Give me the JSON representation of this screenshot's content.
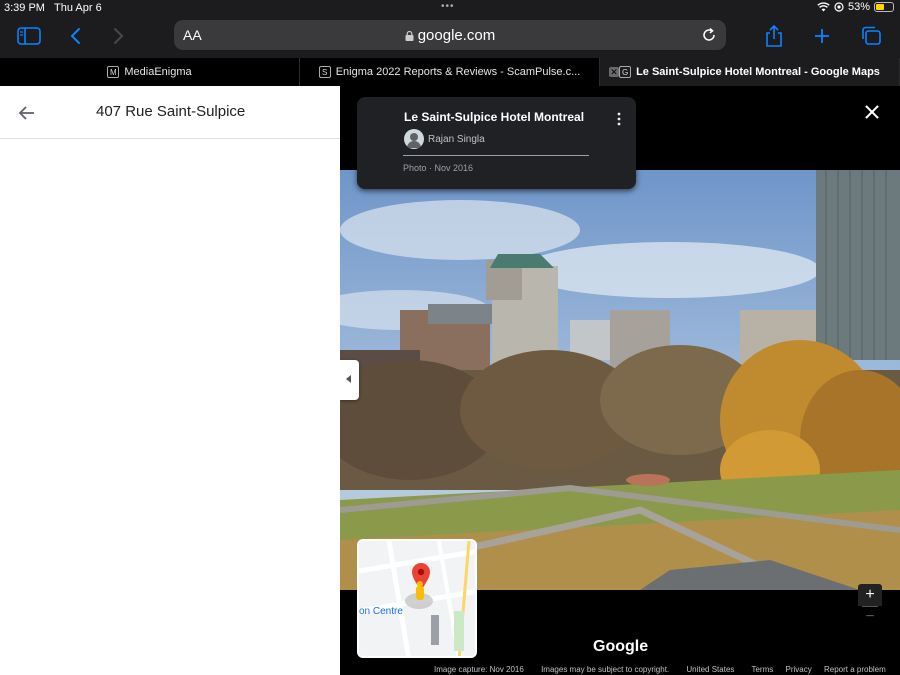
{
  "status_bar": {
    "time": "3:39 PM",
    "date": "Thu Apr 6",
    "battery": "53%",
    "battery_level": 0.53
  },
  "toolbar": {
    "reader_label": "AA",
    "domain": "google.com"
  },
  "tabs": [
    {
      "favicon": "M",
      "label": "MediaEnigma"
    },
    {
      "favicon": "S",
      "label": "Enigma 2022 Reports & Reviews - ScamPulse.c..."
    },
    {
      "favicon": "G",
      "label": "Le Saint-Sulpice Hotel Montreal - Google Maps"
    }
  ],
  "left_panel": {
    "title": "407 Rue Saint-Sulpice"
  },
  "photo_card": {
    "title": "Le Saint-Sulpice Hotel Montreal",
    "author": "Rajan Singla",
    "date": "Photo · Nov 2016"
  },
  "minimap": {
    "label": "on Centre"
  },
  "brand": "Google",
  "footer": {
    "capture": "Image capture: Nov 2016",
    "copyright": "Images may be subject to copyright.",
    "country": "United States",
    "terms": "Terms",
    "privacy": "Privacy",
    "report": "Report a problem"
  },
  "colors": {
    "accent": "#0a84ff",
    "toolbar_bg": "#1c1c1e",
    "pin_red": "#ea4335"
  }
}
